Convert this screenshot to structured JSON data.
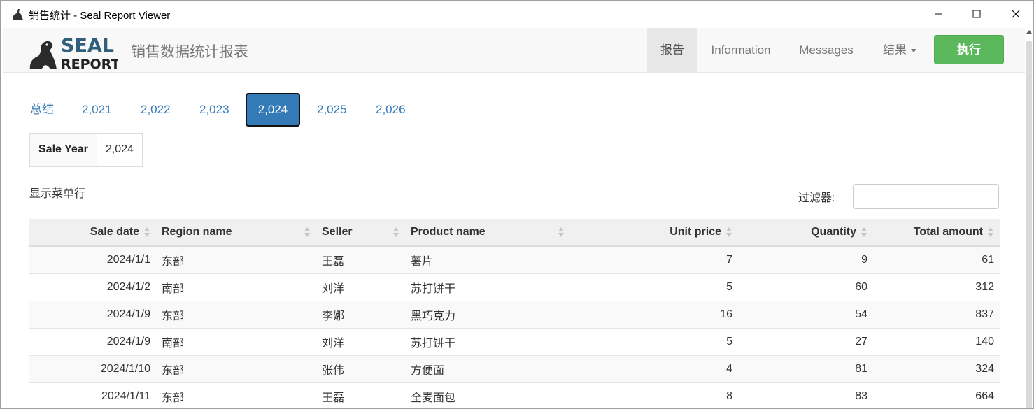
{
  "window": {
    "title": "销售统计 - Seal Report Viewer"
  },
  "navbar": {
    "logo_top": "SEAL",
    "logo_bottom": "REPORT",
    "brand": "销售数据统计报表",
    "items": [
      {
        "label": "报告"
      },
      {
        "label": "Information"
      },
      {
        "label": "Messages"
      },
      {
        "label": "结果"
      }
    ],
    "run_label": "执行"
  },
  "tabs": [
    {
      "label": "总结"
    },
    {
      "label": "2,021"
    },
    {
      "label": "2,022"
    },
    {
      "label": "2,023"
    },
    {
      "label": "2,024"
    },
    {
      "label": "2,025"
    },
    {
      "label": "2,026"
    }
  ],
  "restriction": {
    "key": "Sale Year",
    "value": "2,024"
  },
  "menu_row_label": "显示菜单行",
  "filter": {
    "label": "过滤器:",
    "value": ""
  },
  "table": {
    "columns": [
      "Sale date",
      "Region name",
      "Seller",
      "Product name",
      "Unit price",
      "Quantity",
      "Total amount"
    ],
    "rows": [
      [
        "2024/1/1",
        "东部",
        "王磊",
        "薯片",
        "7",
        "9",
        "61"
      ],
      [
        "2024/1/2",
        "南部",
        "刘洋",
        "苏打饼干",
        "5",
        "60",
        "312"
      ],
      [
        "2024/1/9",
        "东部",
        "李娜",
        "黑巧克力",
        "16",
        "54",
        "837"
      ],
      [
        "2024/1/9",
        "南部",
        "刘洋",
        "苏打饼干",
        "5",
        "27",
        "140"
      ],
      [
        "2024/1/10",
        "东部",
        "张伟",
        "方便面",
        "4",
        "81",
        "324"
      ],
      [
        "2024/1/11",
        "东部",
        "王磊",
        "全麦面包",
        "8",
        "83",
        "664"
      ]
    ]
  },
  "colors": {
    "primary": "#337ab7",
    "success": "#5cb85c",
    "logo": "#2f5f7a"
  }
}
